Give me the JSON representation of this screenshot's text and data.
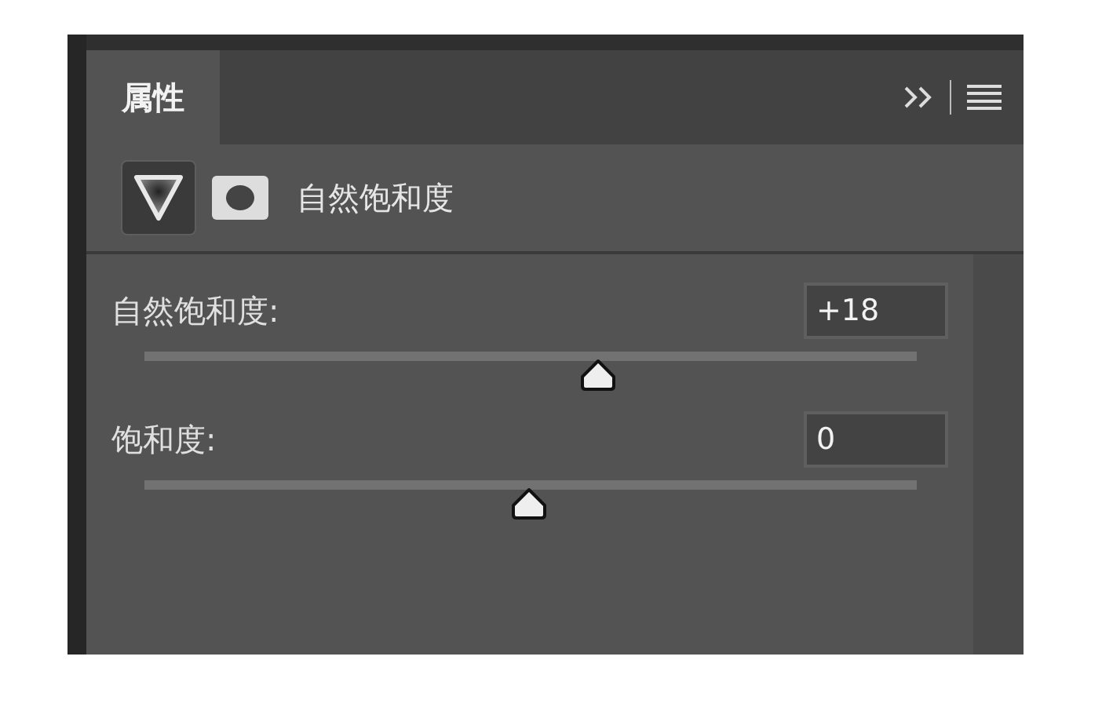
{
  "panel": {
    "tabs": [
      {
        "label": "属性",
        "selected": true
      }
    ]
  },
  "adjustment": {
    "title": "自然饱和度"
  },
  "sliders": [
    {
      "label": "自然饱和度:",
      "value": "+18",
      "level": 0.587
    },
    {
      "label": "饱和度:",
      "value": "0",
      "level": 0.497
    }
  ]
}
